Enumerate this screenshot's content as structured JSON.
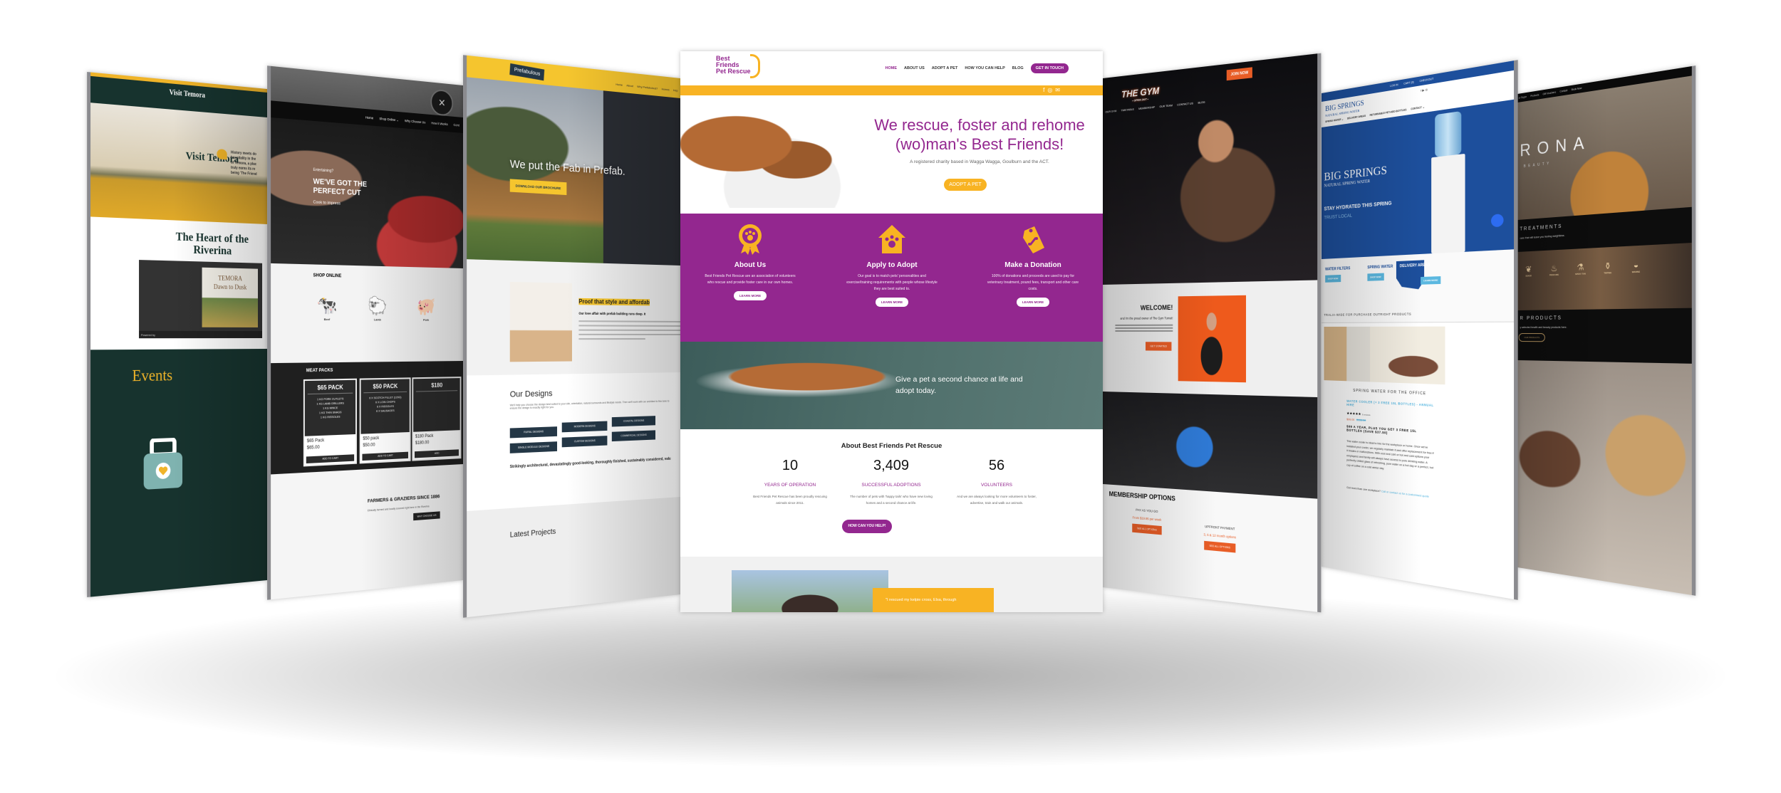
{
  "colors": {
    "purple": "#93278f",
    "yellow": "#f8b323",
    "temora_green": "#17332e",
    "gym_orange": "#e85d26",
    "springs_blue": "#1d4f9c",
    "prefab_yellow": "#f5c52e"
  },
  "center": {
    "logo": [
      "Best",
      "Friends",
      "Pet Rescue"
    ],
    "nav": [
      "HOME",
      "ABOUT US",
      "ADOPT A PET",
      "HOW YOU CAN HELP",
      "BLOG"
    ],
    "cta": "GET IN TOUCH",
    "social_icons": [
      "facebook-icon",
      "instagram-icon",
      "mail-icon"
    ],
    "hero": {
      "title": "We rescue, foster and rehome (wo)man's Best Friends!",
      "subtitle": "A registered charity based in Wagga Wagga, Goulburn and the ACT.",
      "button": "ADOPT A PET"
    },
    "features": [
      {
        "icon": "award-paw-icon",
        "title": "About Us",
        "text": "Best Friends Pet Rescue are an association of volunteers who rescue and provide foster care in our own homes.",
        "button": "LEARN MORE"
      },
      {
        "icon": "house-paw-icon",
        "title": "Apply to Adopt",
        "text": "Our goal is to match pets' personalities and exercise/training requirements with people whose lifestyle they are best suited to.",
        "button": "LEARN MORE"
      },
      {
        "icon": "tag-bone-icon",
        "title": "Make a Donation",
        "text": "100% of donations and proceeds are used to pay for veterinary treatment, pound fees, transport and other care costs.",
        "button": "LEARN MORE"
      }
    ],
    "banner": "Give a pet a second chance at life and adopt today.",
    "about": {
      "title": "About Best Friends Pet Rescue",
      "stats": [
        {
          "value": "10",
          "label": "YEARS OF OPERATION",
          "text": "Best Friends Pet Rescue has been proudly rescuing animals since 2011."
        },
        {
          "value": "3,409",
          "label": "SUCCESSFUL ADOPTIONS",
          "text": "The number of pets with 'happy tails' who have new loving homes and a second chance at life."
        },
        {
          "value": "56",
          "label": "VOLUNTEERS",
          "text": "And we are always looking for more volunteers to foster, advertise, train and walk our animals."
        }
      ],
      "button": "HOW CAN YOU HELP!"
    },
    "testimonial": "\"I rescued my kelpie cross, Elsa, through"
  },
  "temora": {
    "logo": "Visit Temora",
    "hero_text": [
      "History meets do",
      "hospitality in the",
      "of Temora, a plac",
      "truly earns its re",
      "being 'The Friend"
    ],
    "heading": "The Heart of the Riverina",
    "video": {
      "title": "TEMORA",
      "subtitle": "Dawn to Dusk",
      "powered": "Powered by"
    },
    "events": "Events"
  },
  "meat": {
    "nav": [
      "Home",
      "Shop Online ⌄",
      "Why Choose Us",
      "How it Works",
      "Cont"
    ],
    "hero": {
      "kicker": "Entertaining?",
      "title": "WE'VE GOT THE PERFECT CUT",
      "sub": "Cook to impress"
    },
    "shop_title": "SHOP ONLINE",
    "animals": [
      "Beef",
      "Lamb",
      "Pork"
    ],
    "packs_title": "MEAT PACKS",
    "packs": [
      {
        "title": "$65 PACK",
        "items": [
          "1 KG PORK CUTLETS",
          "1 KG LAMB GRILLERS",
          "1 KG MINCE",
          "1 KG THIN SNAGS",
          "1 KG RISSOLES"
        ],
        "name": "$65 Pack",
        "price": "$65.00",
        "button": "ADD TO CART"
      },
      {
        "title": "$50 PACK",
        "items": [
          "6 X SCOTCH FILLET (120G)",
          "6 X LOIN CHOPS",
          "6 X RISSOLES",
          "6 X SAUSAGES"
        ],
        "name": "$50 pack",
        "price": "$50.00",
        "button": "ADD TO CART"
      },
      {
        "title": "$180",
        "items": [],
        "name": "$180 Pack",
        "price": "$180.00",
        "button": "ADD"
      }
    ],
    "farm": {
      "title": "FARMERS & GRAZIERS SINCE 1886",
      "text": "Ethically farmed and locally sourced right here in the Riverina",
      "button": "WHY CHOOSE US"
    }
  },
  "prefab": {
    "logo": "Prefabulous",
    "nav": [
      "Home",
      "About",
      "Why Prefabulous?",
      "Homes",
      "Insp"
    ],
    "hero": {
      "title": "We put the Fab in Prefab.",
      "button": "DOWNLOAD OUR BROCHURE"
    },
    "proof_title": "Proof that style and affordab",
    "proof_sub": "Our love affair with prefab building runs deep. It",
    "designs_title": "Our Designs",
    "designs_text": "We'll help you choose the design best suited to your site, orientation, natural surrounds and lifestyle needs. Then we'll work with our architect to fine-tune to ensure the design is exactly right for you.",
    "design_buttons": [
      "RURAL DESIGNS",
      "MODERN DESIGNS",
      "COASTAL DESIGNS",
      "SINGLE MODULE DESIGNS",
      "CUSTOM DESIGNS",
      "COMMERCIAL DESIGNS"
    ],
    "tagline": "Strikingly architectural, devastatingly good-looking, thoroughly finished, sustainably considered, valu",
    "latest": "Latest Projects"
  },
  "gym": {
    "join": "JOIN NOW",
    "logo": "THE GYM",
    "logo_sub": "• OPEN 24/7 •",
    "nav": [
      "OUR GYM",
      "TIMETABLE",
      "MEMBERSHIP",
      "OUR TEAM",
      "CONTACT US",
      "BLOG"
    ],
    "welcome": "WELCOME!",
    "owner": "and I'm the proud owner of The Gym Tumut!",
    "start": "GET STARTED",
    "membership": {
      "title": "MEMBERSHIP OPTIONS",
      "options": [
        {
          "title": "PAY AS YOU GO",
          "price": "From $19.95 per week",
          "button": "SEE ALL OPTIONS"
        },
        {
          "title": "UPFRONT PAYMENT",
          "price": "3, 6 & 12 month options",
          "button": "SEE ALL OPTIONS"
        }
      ]
    }
  },
  "springs": {
    "top": [
      "LOG IN",
      "CART (0)",
      "CHECKOUT"
    ],
    "logo": "BIG SPRINGS",
    "logo_sub": "NATURAL SPRING WATER",
    "nav": [
      "SPRING WATER ⌄",
      "DELIVERY AREAS",
      "RETURNABLE PET-HDD BOTTLES",
      "CONTACT ⌄"
    ],
    "hero": {
      "title": "BIG SPRINGS",
      "sub": "NATURAL SPRING WATER",
      "tag1": "STAY HYDRATED THIS SPRING",
      "tag2": "TRUST LOCAL"
    },
    "tiles": [
      {
        "title": "WATER FILTERS",
        "button": "SHOP NOW"
      },
      {
        "title": "SPRING WATER",
        "button": "SHOP NOW"
      },
      {
        "title": "DELIVERY AREAS",
        "button": "LEARN MORE"
      }
    ],
    "aus": "TRALIA-WIDE FOR PURCHASE OUTRIGHT PRODUCTS",
    "office": "SPRING WATER FOR THE OFFICE",
    "product": "WATER COOLER (+ 3 FREE 15L BOTTLES) - ANNUAL HIRE",
    "reviews": "6 reviews",
    "rating": 5,
    "price": "$99.00",
    "old_price": "$136.50",
    "deal": "$99 A YEAR, PLUS YOU GET 3 FREE 15L BOTTLES (SAVE $37.50)",
    "desc": "This water cooler is ideal to hire for the workplace or home. Once we've installed your cooler, we regularly maintain it and offer replacement for free if it breaks or malfunctions. With cool and cold or hot and cold options your employees and family will always have access to pure drinking water. A perfectly chilled glass of refreshing, pure water on a hot day or a perfect, hot cup of coffee on a cold winter day.",
    "more": "Got more than one workplace?",
    "more_link": "Call or contact us for a customised quote"
  },
  "rona": {
    "nav": [
      "ur Super",
      "Products",
      "Gift Vouchers",
      "Contact",
      "Book Now"
    ],
    "logo": "RONA",
    "logo_sub": "BEAUTY",
    "treatments": "TREATMENTS",
    "treat_text": "care that will leave you feeling weightless.",
    "icons": [
      "SSAGE",
      "PEDICURE",
      "SPRAY TAN",
      "TINTING",
      "WAXING"
    ],
    "products": "R PRODUCTS",
    "products_text": "y selected health and beauty products here.",
    "button": "OUR PRODUCTS"
  }
}
